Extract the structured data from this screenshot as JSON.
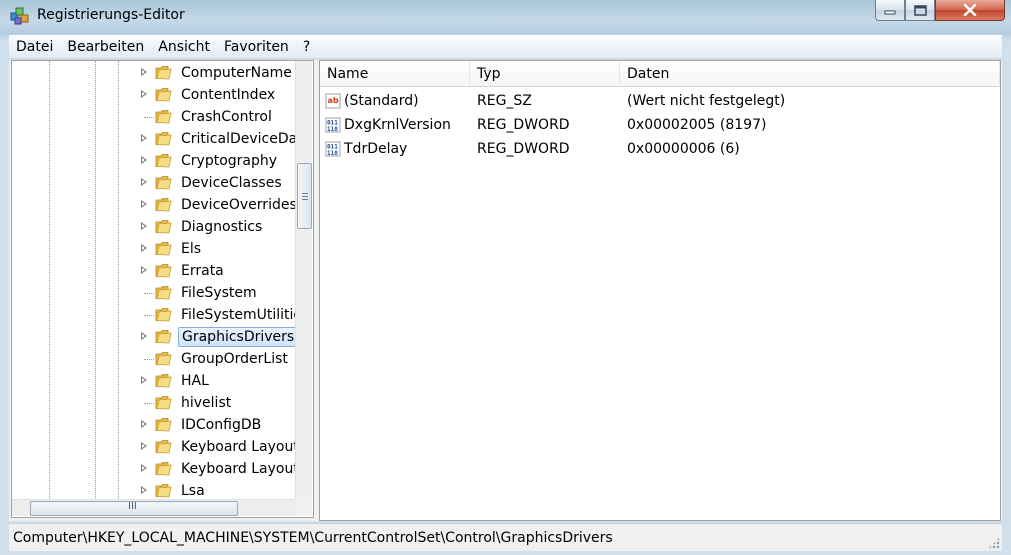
{
  "window": {
    "title": "Registrierungs-Editor",
    "controls": {
      "minimize": "minimize",
      "maximize": "maximize",
      "close": "close"
    },
    "colors": {
      "frame": "#b9cfe1",
      "close_button": "#c94a30",
      "selection": "#cde4fb"
    }
  },
  "menu": [
    "Datei",
    "Bearbeiten",
    "Ansicht",
    "Favoriten",
    "?"
  ],
  "tree": {
    "items": [
      {
        "label": "ComputerName",
        "expandable": true,
        "selected": false
      },
      {
        "label": "ContentIndex",
        "expandable": true,
        "selected": false
      },
      {
        "label": "CrashControl",
        "expandable": false,
        "selected": false
      },
      {
        "label": "CriticalDeviceDat",
        "expandable": true,
        "selected": false
      },
      {
        "label": "Cryptography",
        "expandable": true,
        "selected": false
      },
      {
        "label": "DeviceClasses",
        "expandable": true,
        "selected": false
      },
      {
        "label": "DeviceOverrides",
        "expandable": true,
        "selected": false
      },
      {
        "label": "Diagnostics",
        "expandable": true,
        "selected": false
      },
      {
        "label": "Els",
        "expandable": true,
        "selected": false
      },
      {
        "label": "Errata",
        "expandable": true,
        "selected": false
      },
      {
        "label": "FileSystem",
        "expandable": false,
        "selected": false
      },
      {
        "label": "FileSystemUtilitie",
        "expandable": false,
        "selected": false
      },
      {
        "label": "GraphicsDrivers",
        "expandable": true,
        "selected": true
      },
      {
        "label": "GroupOrderList",
        "expandable": false,
        "selected": false
      },
      {
        "label": "HAL",
        "expandable": true,
        "selected": false
      },
      {
        "label": "hivelist",
        "expandable": false,
        "selected": false
      },
      {
        "label": "IDConfigDB",
        "expandable": true,
        "selected": false
      },
      {
        "label": "Keyboard Layout",
        "expandable": true,
        "selected": false
      },
      {
        "label": "Keyboard Layout",
        "expandable": true,
        "selected": false
      },
      {
        "label": "Lsa",
        "expandable": true,
        "selected": false
      }
    ],
    "hscroll_grip": "III"
  },
  "list": {
    "columns": [
      "Name",
      "Typ",
      "Daten"
    ],
    "rows": [
      {
        "icon": "string-value-icon",
        "name": "(Standard)",
        "type": "REG_SZ",
        "data": "(Wert nicht festgelegt)"
      },
      {
        "icon": "binary-value-icon",
        "name": "DxgKrnlVersion",
        "type": "REG_DWORD",
        "data": "0x00002005 (8197)"
      },
      {
        "icon": "binary-value-icon",
        "name": "TdrDelay",
        "type": "REG_DWORD",
        "data": "0x00000006 (6)"
      }
    ]
  },
  "statusbar": {
    "path": "Computer\\HKEY_LOCAL_MACHINE\\SYSTEM\\CurrentControlSet\\Control\\GraphicsDrivers"
  }
}
